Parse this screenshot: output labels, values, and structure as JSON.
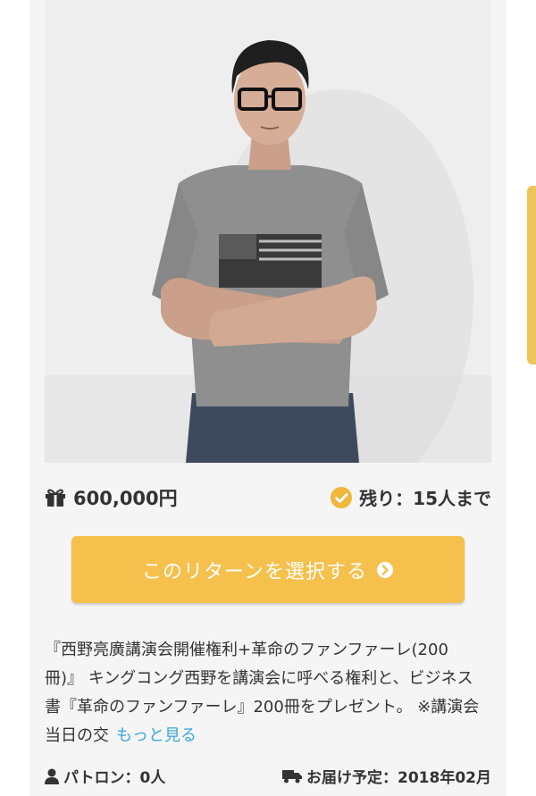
{
  "reward": {
    "price": "600,000円",
    "remaining": "残り：15人まで",
    "select_button_label": "このリターンを選択する",
    "description": "『西野亮廣講演会開催権利+革命のファンファーレ(200冊)』 キングコング西野を講演会に呼べる権利と、ビジネス書『革命のファンファーレ』200冊をプレゼント。 ※講演会当日の交",
    "more_label": "もっと見る",
    "patrons": "パトロン：0人",
    "delivery": "お届け予定：2018年02月"
  },
  "colors": {
    "accent": "#f5c04c",
    "check": "#f0b73a",
    "link": "#3aa7d8",
    "text": "#333333",
    "card_bg": "#f5f5f6"
  },
  "icons": [
    "gift-icon",
    "check-circle-icon",
    "chevron-right-circle-icon",
    "user-icon",
    "truck-icon"
  ]
}
